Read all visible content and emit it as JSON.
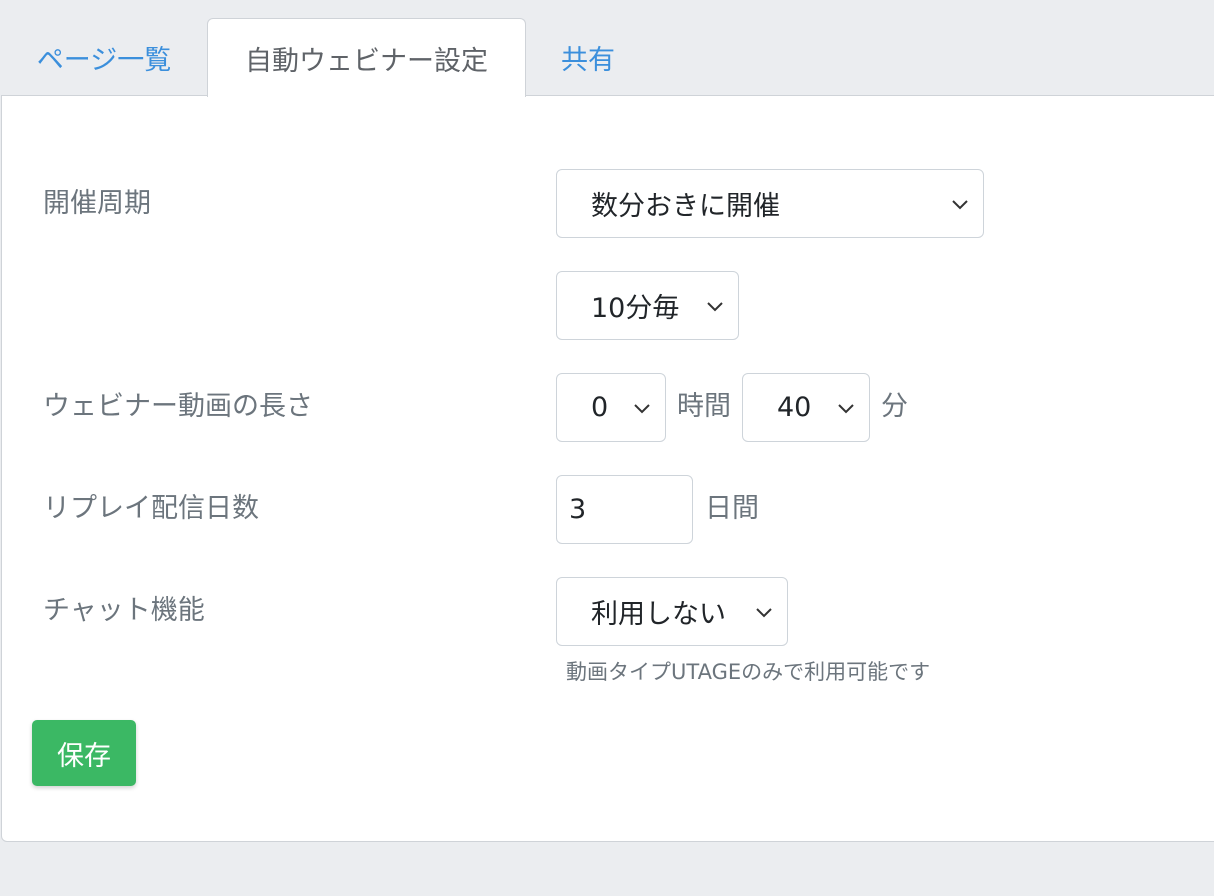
{
  "tabs": [
    {
      "label": "ページ一覧",
      "active": false
    },
    {
      "label": "自動ウェビナー設定",
      "active": true
    },
    {
      "label": "共有",
      "active": false
    }
  ],
  "form": {
    "schedule": {
      "label": "開催周期",
      "value": "数分おきに開催"
    },
    "interval": {
      "value": "10分毎"
    },
    "video_length": {
      "label": "ウェビナー動画の長さ",
      "hours_value": "0",
      "hours_unit": "時間",
      "minutes_value": "40",
      "minutes_unit": "分"
    },
    "replay": {
      "label": "リプレイ配信日数",
      "value": "3",
      "unit": "日間"
    },
    "chat": {
      "label": "チャット機能",
      "value": "利用しない",
      "hint": "動画タイプUTAGEのみで利用可能です"
    }
  },
  "actions": {
    "save_label": "保存"
  },
  "colors": {
    "link": "#3b8fdc",
    "primary_button": "#3bb864",
    "label_text": "#6c757d",
    "background": "#ebedf0"
  }
}
